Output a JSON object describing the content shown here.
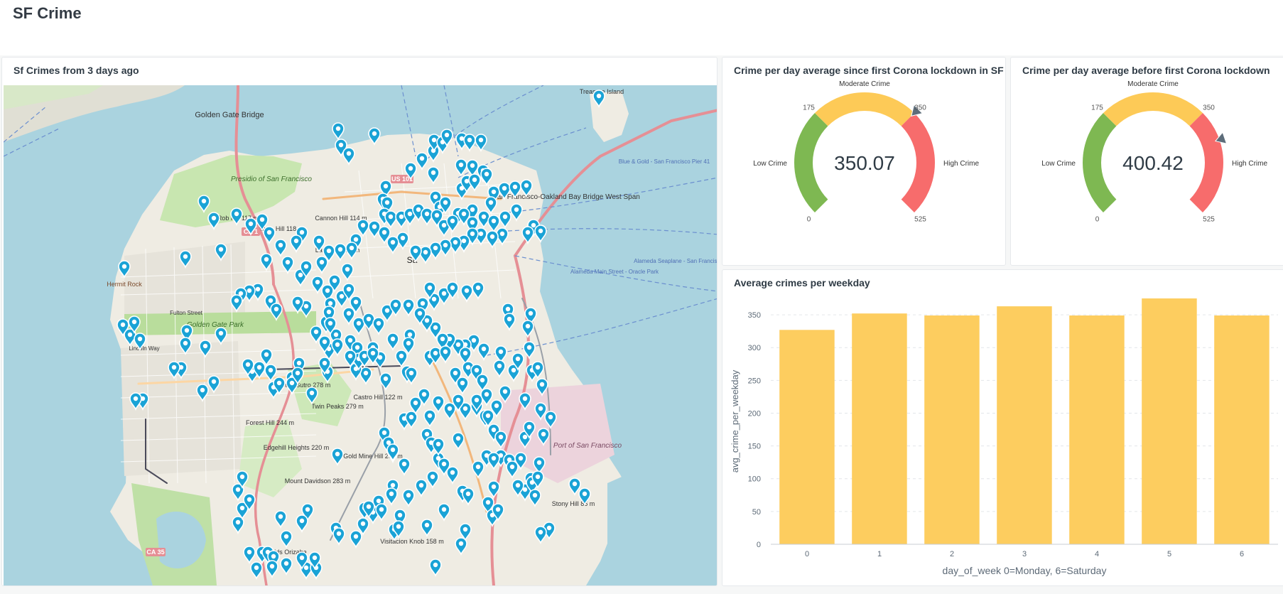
{
  "dashboard": {
    "title": "SF Crime"
  },
  "map_panel": {
    "title": "Sf Crimes from 3 days ago",
    "labels": {
      "golden_gate_bridge": "Golden Gate Bridge",
      "treasure_island": "Treasure Island",
      "bay_bridge": "San Francisco-Oakland Bay Bridge West Span",
      "presidio": "Presidio of San Francisco",
      "rob_hill": "Rob Hill 117 m",
      "presidio_hill": "Presidio Hill 118 m",
      "cannon_hill": "Cannon Hill 114 m",
      "laurel_hill": "Laurel Hill 99 m",
      "golden_gate_park": "Golden Gate Park",
      "fulton_street": "Fulton Street",
      "lincoln_way": "Lincoln Way",
      "mount_sutro": "Mount Sutro 278 m",
      "twin_peaks": "Twin Peaks 279 m",
      "castro_hill": "Castro Hill 122 m",
      "forest_hill": "Forest Hill 244 m",
      "edgehill": "Edgehill Heights 220 m",
      "mount_davidson": "Mount Davidson 283 m",
      "gold_mine_hill": "Gold Mine Hill 206 m",
      "port_sf": "Port of San Francisco",
      "stony_hill": "Stony Hill 86 m",
      "visitacion": "Visitacion Knob 158 m",
      "shields": "Shields Orizaba",
      "ca1": "CA 1",
      "ca35": "CA 35",
      "us101": "US 101",
      "hermit_rock": "Hermit Rock",
      "sa_label": "Sa",
      "pier41": "Blue & Gold - San Francisco Pier 41",
      "alameda_main": "Alameda Main Street - Oracle Park",
      "alameda_seaplane": "Alameda Seaplane - San Francisco"
    }
  },
  "gauge_since": {
    "title": "Crime per day average since first Corona lockdown in SF",
    "value_text": "350.07",
    "value": 350.07,
    "min": 0,
    "max": 525,
    "ticks": [
      "0",
      "175",
      "350",
      "525"
    ],
    "band_low": "Low Crime",
    "band_mid": "Moderate Crime",
    "band_high": "High Crime",
    "colors": {
      "low": "#7eb852",
      "mid": "#fdca57",
      "high": "#f76c6c",
      "pointer": "#5d6d7a"
    }
  },
  "gauge_before": {
    "title": "Crime per day average before first Corona lockdown",
    "value_text": "400.42",
    "value": 400.42,
    "min": 0,
    "max": 525,
    "ticks": [
      "0",
      "175",
      "350",
      "525"
    ],
    "band_low": "Low Crime",
    "band_mid": "Moderate Crime",
    "band_high": "High Crime",
    "colors": {
      "low": "#7eb852",
      "mid": "#fdca57",
      "high": "#f76c6c",
      "pointer": "#5d6d7a"
    }
  },
  "chart_data": {
    "type": "bar",
    "title": "Average crimes per weekday",
    "xlabel": "day_of_week 0=Monday, 6=Saturday",
    "ylabel": "avg_crime_per_weekday",
    "categories": [
      "0",
      "1",
      "2",
      "3",
      "4",
      "5",
      "6"
    ],
    "values": [
      327,
      352,
      349,
      363,
      349,
      375,
      349
    ],
    "ylim": [
      0,
      375
    ],
    "yticks": [
      0,
      50,
      100,
      150,
      200,
      250,
      300,
      350
    ],
    "grid": true,
    "bar_color": "#fdcd5f"
  }
}
